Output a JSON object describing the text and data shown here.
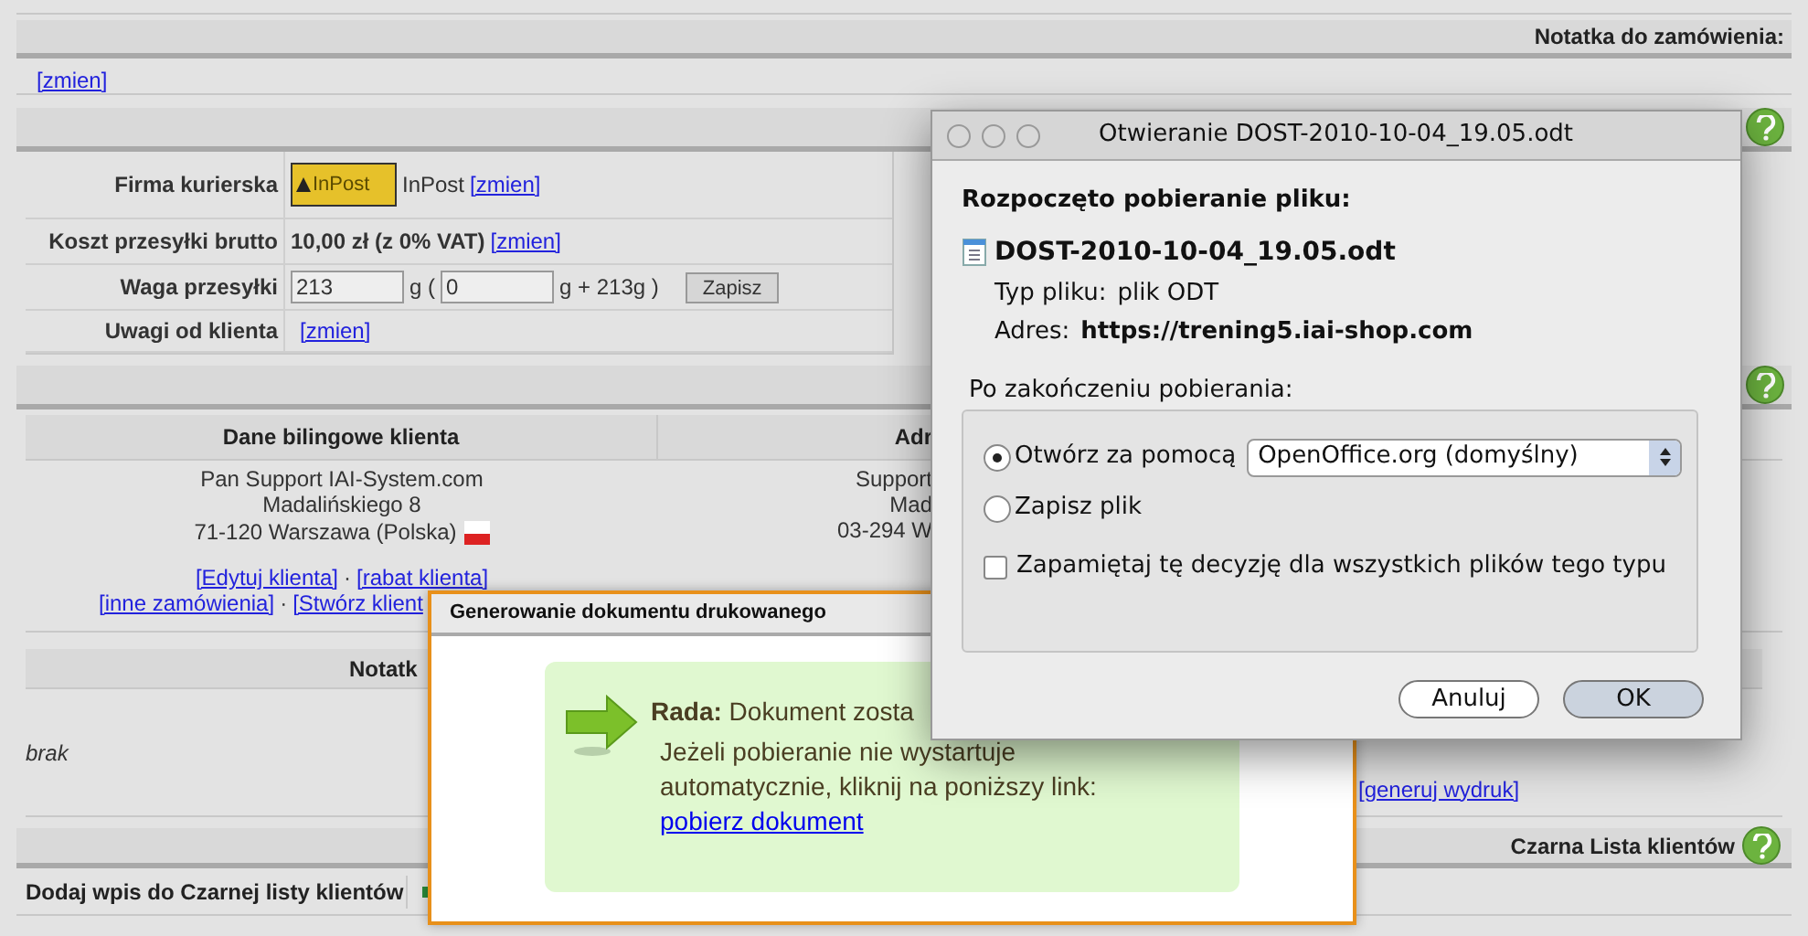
{
  "order_note": {
    "title": "Notatka do zamówienia:",
    "link": "[zmien]"
  },
  "shipping": {
    "rows": [
      {
        "kind": "courier",
        "label": "Firma kurierska",
        "logo_text": "InPost",
        "value": "InPost",
        "link": "[zmien]"
      },
      {
        "kind": "cost",
        "label": "Koszt przesyłki brutto",
        "value": "10,00 zł (z 0% VAT)",
        "link": "[zmien]"
      },
      {
        "kind": "weight",
        "label": "Waga przesyłki",
        "weight_value": "213",
        "unit_open": "g (",
        "extra_value": "0",
        "unit_close": "g + 213g )",
        "button": "Zapisz"
      },
      {
        "kind": "notes",
        "label": "Uwagi od klienta",
        "link": "[zmien]"
      }
    ]
  },
  "client": {
    "columns": [
      "Dane bilingowe klienta",
      "Adr"
    ],
    "billing_lines": [
      "Pan Support IAI-System.com",
      "Madalińskiego 8",
      "71-120 Warszawa (Polska)"
    ],
    "delivery_lines": [
      "Support",
      "Mad",
      "03-294 W"
    ],
    "links_row_1": [
      "[Edytuj klienta]",
      "[rabat klienta]"
    ],
    "separator_1": "·",
    "links_row_2": [
      "[inne zamówienia]",
      "[Stwórz klient"
    ],
    "separator_2": "·",
    "note_header": "Notatk",
    "note_value": "brak",
    "print_link": "[generuj wydruk]"
  },
  "blacklist": {
    "title": "Czarna Lista klientów",
    "row_label": "Dodaj wpis do Czarnej listy klientów"
  },
  "print_dialog": {
    "title": "Generowanie dokumentu drukowanego",
    "tip_label": "Rada:",
    "tip_text": "Dokument zosta",
    "tip_body": "Jeżeli pobieranie nie wystartuje automatycznie, kliknij na poniższy link:",
    "link": "pobierz dokument"
  },
  "download_dialog": {
    "title": "Otwieranie DOST-2010-10-04_19.05.odt",
    "heading": "Rozpoczęto pobieranie pliku:",
    "file_name": "DOST-2010-10-04_19.05.odt",
    "type_label": "Typ pliku:",
    "type_value": "plik ODT",
    "address_label": "Adres:",
    "address_value": "https://trening5.iai-shop.com",
    "group_label": "Po zakończeniu pobierania:",
    "options": [
      {
        "label": "Otwórz za pomocą",
        "selected": true,
        "app": "OpenOffice.org (domyślny)"
      },
      {
        "label": "Zapisz plik",
        "selected": false
      }
    ],
    "remember": {
      "label": "Zapamiętaj tę decyzję dla wszystkich plików tego typu",
      "checked": false
    },
    "buttons": [
      "Anuluj",
      "OK"
    ]
  }
}
